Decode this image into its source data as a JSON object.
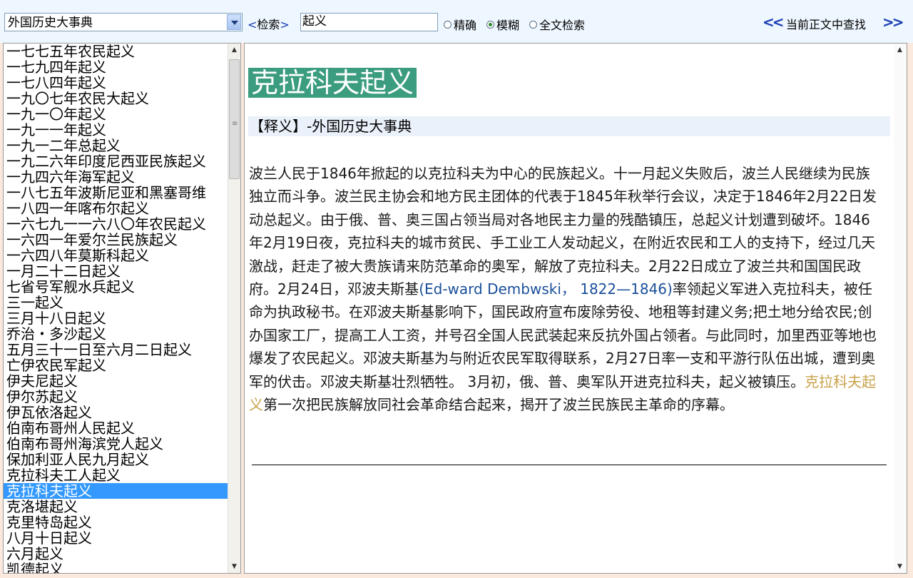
{
  "toolbar": {
    "dictionary": "外国历史大事典",
    "search_bracket_open": "<",
    "search_label": "检索",
    "search_bracket_close": ">",
    "search_value": "起义",
    "radio_exact": "精确",
    "radio_fuzzy": "模糊",
    "radio_fulltext": "全文检索",
    "selected_radio": "模糊",
    "nav_prev": "<<",
    "nav_label": "当前正文中查找",
    "nav_next": ">>"
  },
  "list": {
    "selected": "克拉科夫起义",
    "items": [
      "一七七五年农民起义",
      "一七九四年起义",
      "一七八四年起义",
      "一九〇七年农民大起义",
      "一九一〇年起义",
      "一九一一年起义",
      "一九一二年总起义",
      "一九二六年印度尼西亚民族起义",
      "一九四六年海军起义",
      "一八七五年波斯尼亚和黑塞哥维",
      "一八四一年喀布尔起义",
      "一六七九一一六八〇年农民起义",
      "一六四一年爱尔兰民族起义",
      "一六四八年莫斯科起义",
      "一月二十二日起义",
      "七省号军舰水兵起义",
      "三一起义",
      "三月十八日起义",
      "乔治・多沙起义",
      "五月三十一日至六月二日起义",
      "亡伊农民军起义",
      "伊夫尼起义",
      "伊尔苏起义",
      "伊瓦依洛起义",
      "伯南布哥州人民起义",
      "伯南布哥州海滨党人起义",
      "保加利亚人民九月起义",
      "克拉科夫工人起义",
      "克拉科夫起义",
      "克洛堪起义",
      "克里特岛起义",
      "八月十日起义",
      "六月起义",
      "凯德起义"
    ]
  },
  "entry": {
    "title": "克拉科夫起义",
    "source": "【释义】-外国历史大事典",
    "body_part1": "波兰人民于1846年掀起的以克拉科夫为中心的民族起义。十一月起义失败后，波兰人民继续为民族独立而斗争。波兰民主协会和地方民主团体的代表于1845年秋举行会议，决定于1846年2月22日发动总起义。由于俄、普、奥三国占领当局对各地民主力量的残酷镇压，总起义计划遭到破坏。1846年2月19日夜，克拉科夫的城市贫民、手工业工人发动起义，在附近农民和工人的支持下，经过几天激战，赶走了被大贵族请来防范革命的奥军，解放了克拉科夫。2月22日成立了波兰共和国国民政府。2月24日，邓波夫斯基",
    "body_english": "(Ed-ward Dembwski， 1822—1846)",
    "body_part2": "率领起义军进入克拉科夫，被任命为执政秘书。在邓波夫斯基影响下，国民政府宣布废除劳役、地租等封建义务;把土地分给农民;创办国家工厂，提高工人工资，并号召全国人民武装起来反抗外国占领者。与此同时，加里西亚等地也爆发了农民起义。邓波夫斯基为与附近农民军取得联系，2月27日率一支和平游行队伍出城，遭到奥军的伏击。邓波夫斯基壮烈牺牲。 3月初，俄、普、奥军队开进克拉科夫，起义被镇压。",
    "body_keyword": "克拉科夫起义",
    "body_part3": "第一次把民族解放同社会革命结合起来，揭开了波兰民族民主革命的序幕。"
  },
  "colors": {
    "title_bg": "#3b9c7f",
    "selection": "#3399ff",
    "keyword": "#c9a24a",
    "english": "#1a4f9a"
  }
}
